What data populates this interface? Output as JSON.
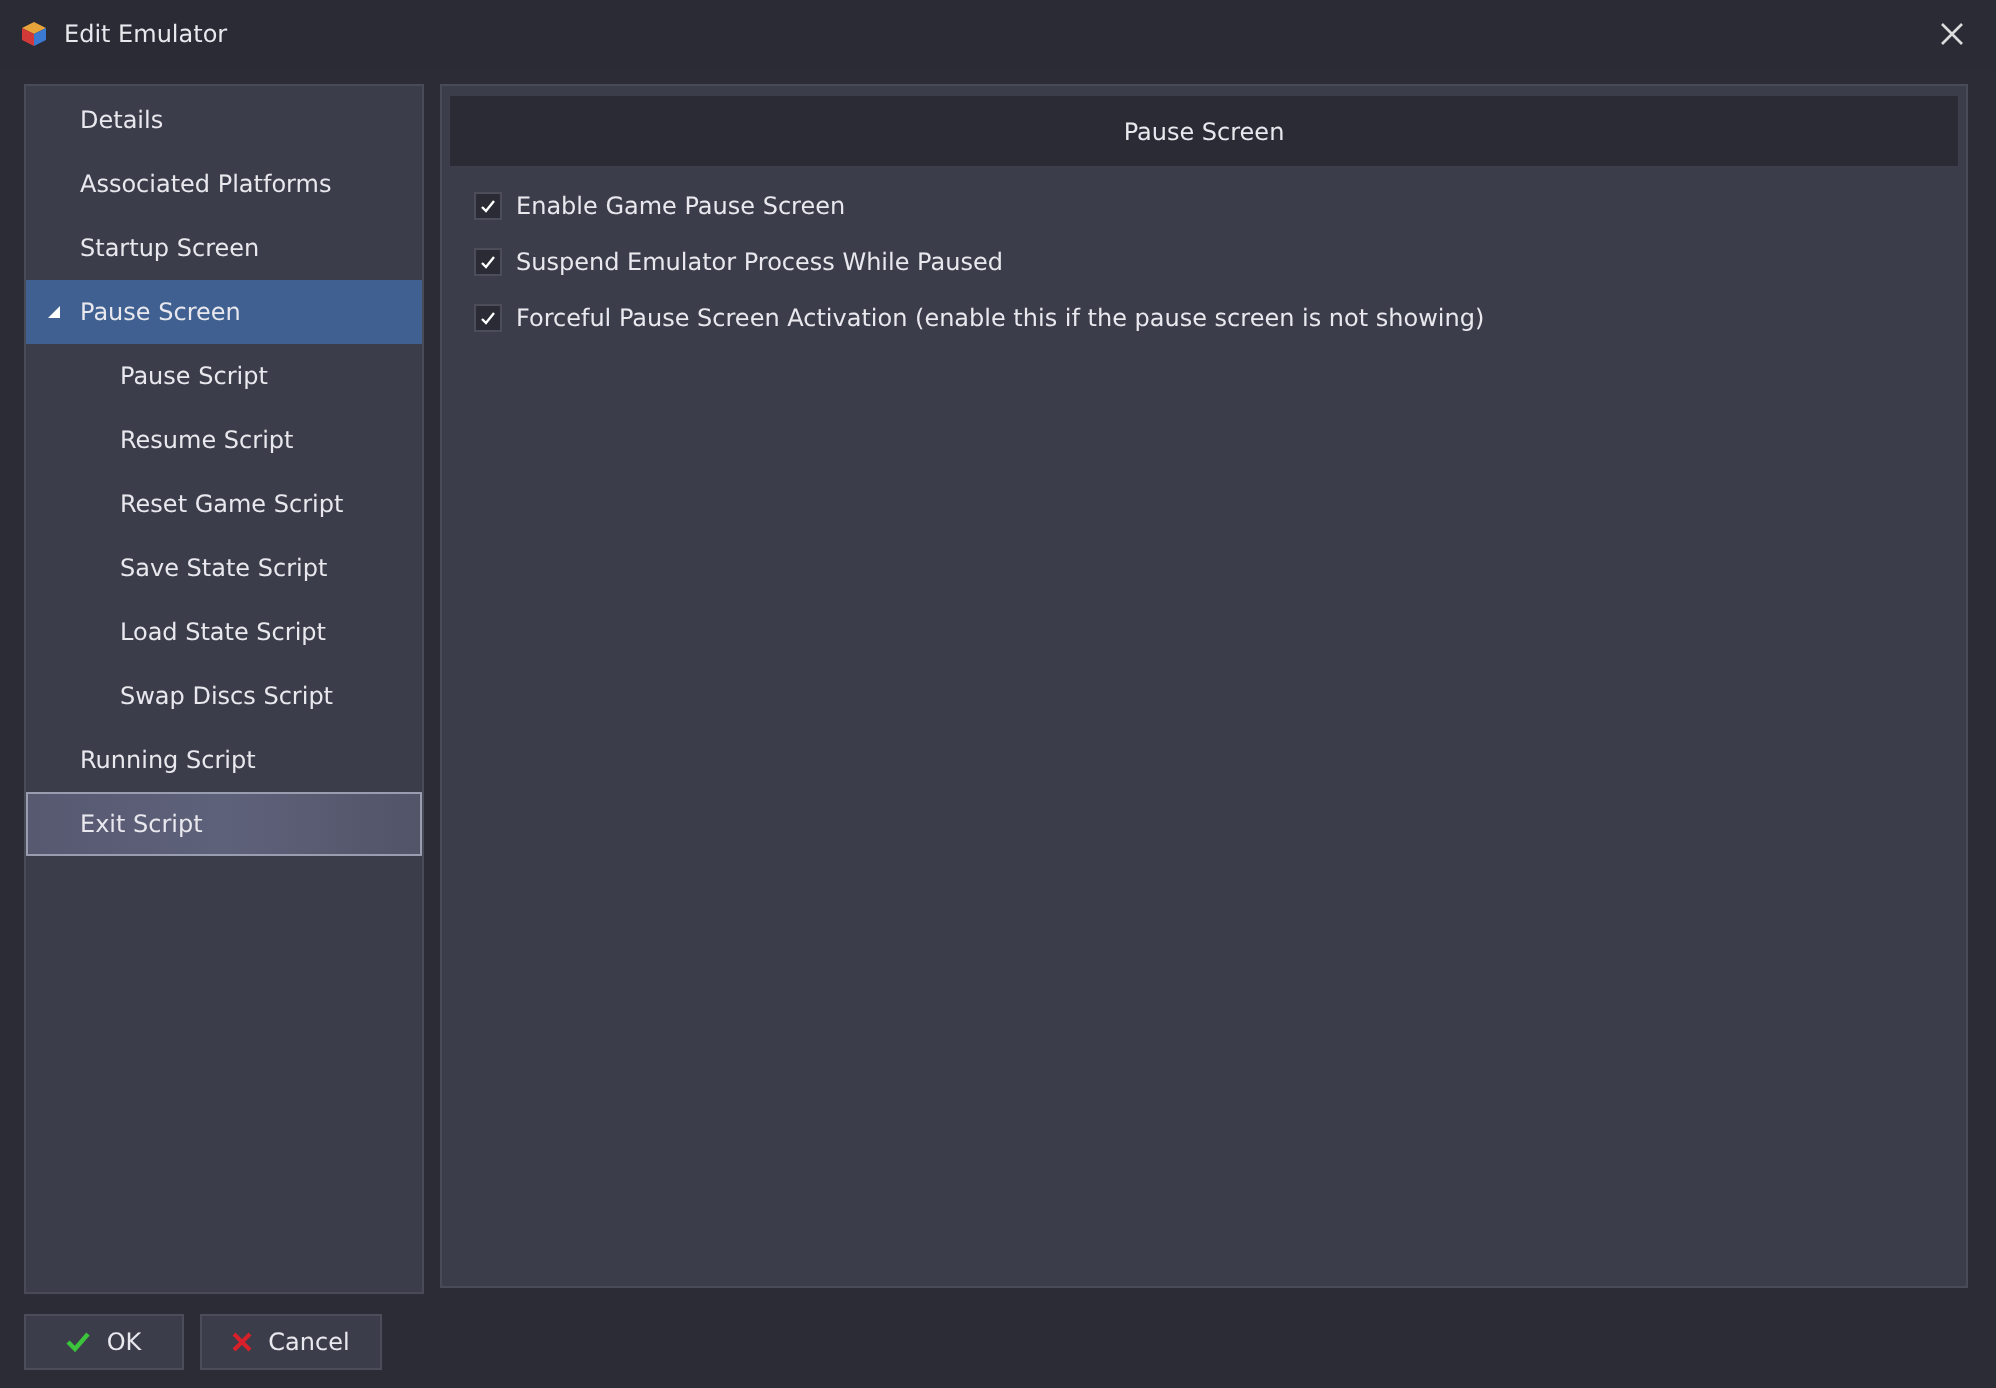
{
  "window": {
    "title": "Edit Emulator"
  },
  "sidebar": {
    "items": [
      {
        "label": "Details",
        "selected": false,
        "hovered": false
      },
      {
        "label": "Associated Platforms",
        "selected": false,
        "hovered": false
      },
      {
        "label": "Startup Screen",
        "selected": false,
        "hovered": false
      },
      {
        "label": "Pause Screen",
        "selected": true,
        "hovered": false,
        "expanded": true,
        "children": [
          {
            "label": "Pause Script",
            "selected": false,
            "hovered": false
          },
          {
            "label": "Resume Script",
            "selected": false,
            "hovered": false
          },
          {
            "label": "Reset Game Script",
            "selected": false,
            "hovered": false
          },
          {
            "label": "Save State Script",
            "selected": false,
            "hovered": false
          },
          {
            "label": "Load State Script",
            "selected": false,
            "hovered": false
          },
          {
            "label": "Swap Discs Script",
            "selected": false,
            "hovered": false
          }
        ]
      },
      {
        "label": "Running Script",
        "selected": false,
        "hovered": false
      },
      {
        "label": "Exit Script",
        "selected": false,
        "hovered": true
      }
    ]
  },
  "panel": {
    "header": "Pause Screen",
    "options": [
      {
        "label": "Enable Game Pause Screen",
        "checked": true
      },
      {
        "label": "Suspend Emulator Process While Paused",
        "checked": true
      },
      {
        "label": "Forceful Pause Screen Activation (enable this if the pause screen is not showing)",
        "checked": true
      }
    ]
  },
  "buttons": [
    {
      "label": "OK",
      "kind": "ok"
    },
    {
      "label": "Cancel",
      "kind": "cancel"
    }
  ]
}
